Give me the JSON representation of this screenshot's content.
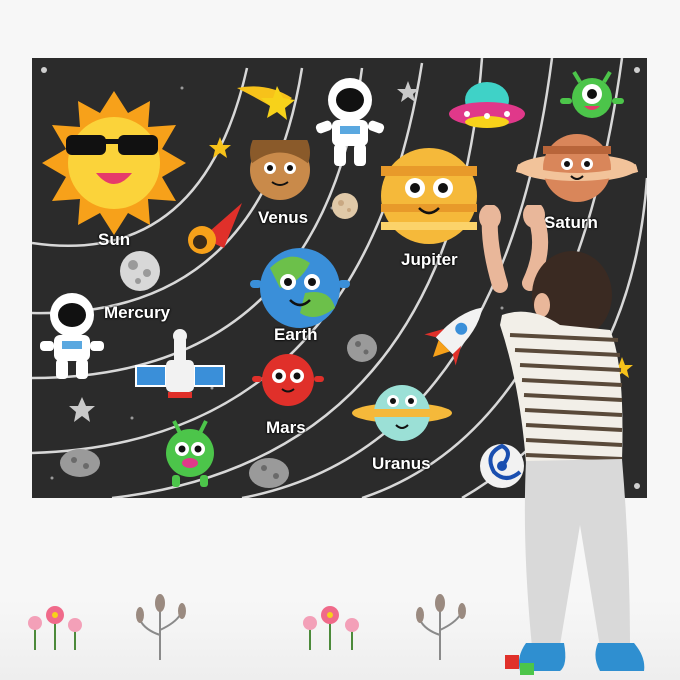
{
  "banner": {
    "labels": {
      "sun": "Sun",
      "mercury": "Mercury",
      "venus": "Venus",
      "earth": "Earth",
      "mars": "Mars",
      "jupiter": "Jupiter",
      "saturn": "Saturn",
      "uranus": "Uranus"
    }
  },
  "colors": {
    "felt_background": "#2b2b2b",
    "orbit_lines": "#d8d8d8",
    "sun": "#f7a11a",
    "jupiter": "#f5b93a",
    "earth_ocean": "#3a8fd9",
    "earth_land": "#6cc04a",
    "mars": "#e0302a",
    "uranus": "#9be0d6",
    "saturn": "#d9865a"
  },
  "icons": [
    "sun-icon",
    "astronaut-icon",
    "comet-icon",
    "rocket-icon",
    "ufo-icon",
    "alien-icon",
    "satellite-icon",
    "galaxy-icon",
    "star-icon",
    "moon-icon",
    "asteroid-icon"
  ]
}
